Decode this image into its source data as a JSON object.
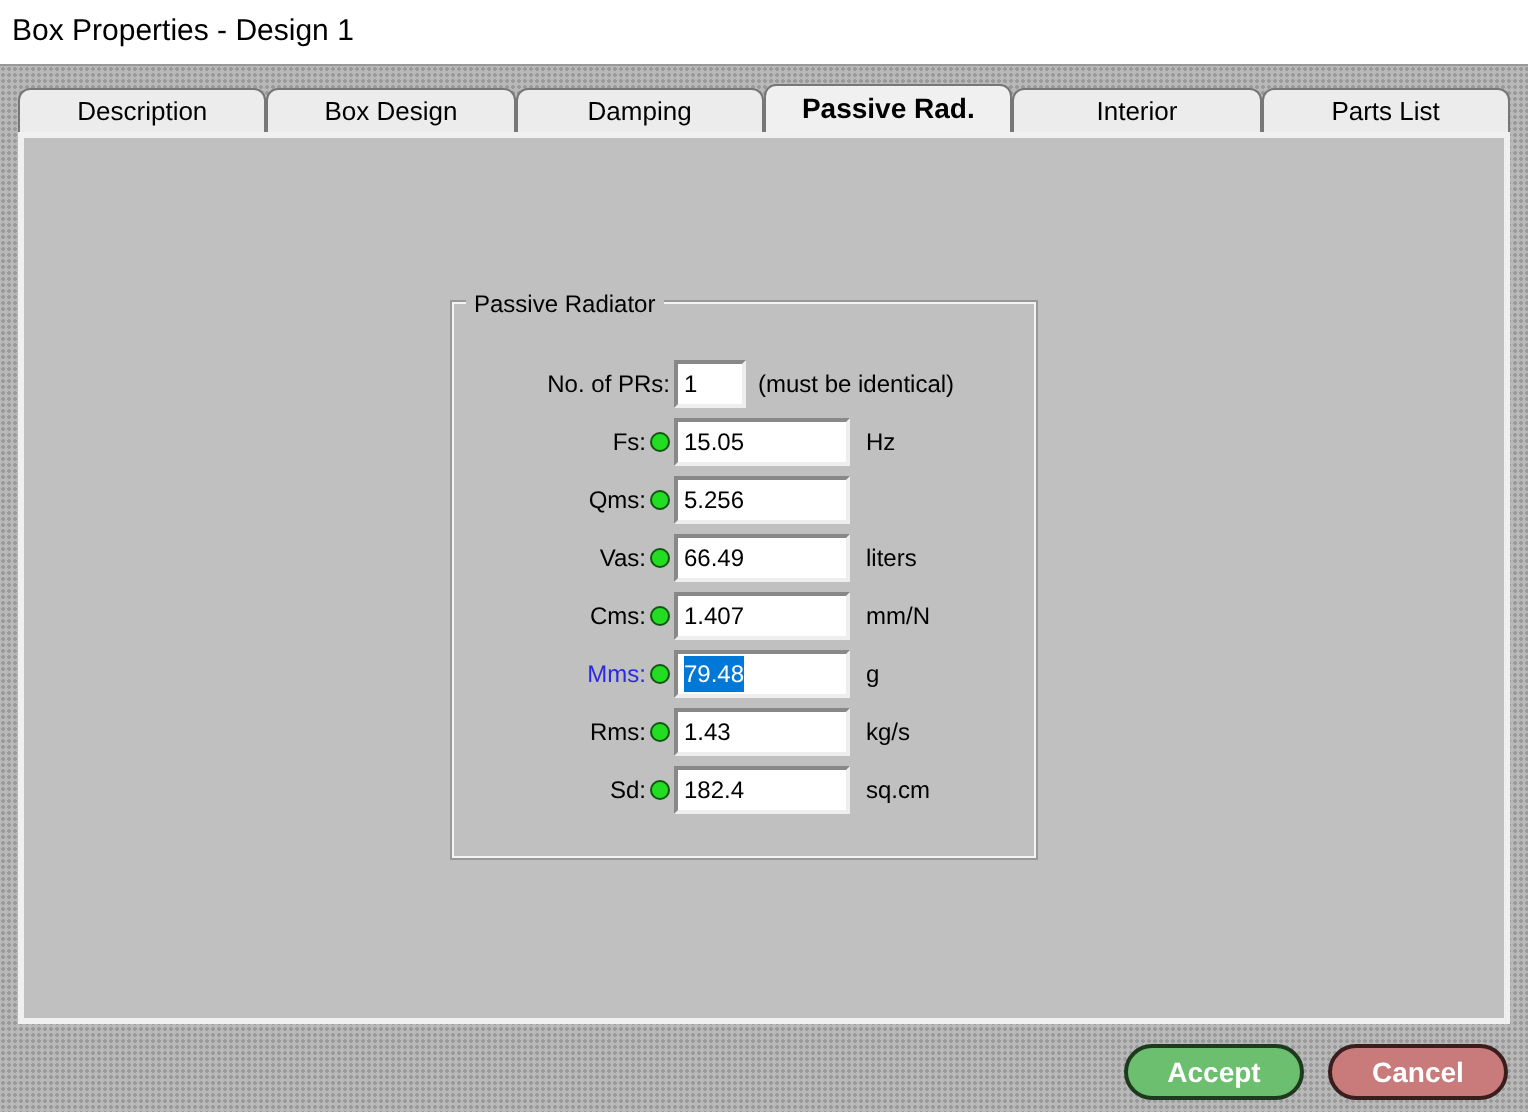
{
  "window": {
    "title": "Box Properties - Design 1"
  },
  "tabs": [
    {
      "label": "Description",
      "selected": false
    },
    {
      "label": "Box Design",
      "selected": false
    },
    {
      "label": "Damping",
      "selected": false
    },
    {
      "label": "Passive Rad.",
      "selected": true
    },
    {
      "label": "Interior",
      "selected": false
    },
    {
      "label": "Parts List",
      "selected": false
    }
  ],
  "group": {
    "title": "Passive Radiator",
    "fields": [
      {
        "kind": "count",
        "label": "No. of PRs:",
        "value": "1",
        "note": "(must be identical)",
        "selected": false
      },
      {
        "kind": "param",
        "label": "Fs:",
        "value": "15.05",
        "unit": "Hz",
        "selected": false
      },
      {
        "kind": "param",
        "label": "Qms:",
        "value": "5.256",
        "selected": false
      },
      {
        "kind": "param",
        "label": "Vas:",
        "value": "66.49",
        "unit": "liters",
        "selected": false
      },
      {
        "kind": "param",
        "label": "Cms:",
        "value": "1.407",
        "unit": "mm/N",
        "selected": false
      },
      {
        "kind": "param",
        "label": "Mms:",
        "value": "79.48",
        "unit": "g",
        "selected": true
      },
      {
        "kind": "param",
        "label": "Rms:",
        "value": "1.43",
        "unit": "kg/s",
        "selected": false
      },
      {
        "kind": "param",
        "label": "Sd:",
        "value": "182.4",
        "unit": "sq.cm",
        "selected": false
      }
    ]
  },
  "buttons": [
    {
      "kind": "accept",
      "label": "Accept"
    },
    {
      "kind": "cancel",
      "label": "Cancel"
    }
  ]
}
